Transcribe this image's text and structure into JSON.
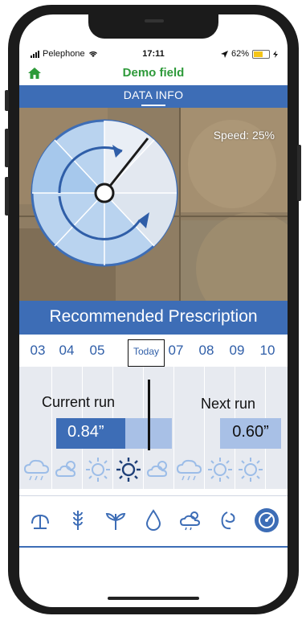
{
  "status": {
    "carrier": "Pelephone",
    "time": "17:11",
    "battery": "62%",
    "battery_level": 0.62
  },
  "header": {
    "title": "Demo field"
  },
  "data_bar": {
    "title": "DATA INFO"
  },
  "map": {
    "speed_text": "Speed: 25%"
  },
  "prescription": {
    "title": "Recommended Prescription",
    "days": [
      "03",
      "04",
      "05",
      "Today",
      "07",
      "08",
      "09",
      "10"
    ],
    "current_label": "Current run",
    "current_value": "0.84”",
    "current_fraction": 0.6,
    "next_label": "Next run",
    "next_value": "0.60”"
  },
  "weather": [
    "rain-cloud-icon",
    "cloudy-sun-icon",
    "sun-icon",
    "sun-icon",
    "cloudy-sun-icon",
    "rain-cloud-icon",
    "sun-icon",
    "sun-icon"
  ],
  "bottom_nav": [
    "pivot-icon",
    "wheat-icon",
    "plant-icon",
    "water-drop-icon",
    "weather-icon",
    "crop-icon",
    "irrigation-target-icon"
  ],
  "colors": {
    "brand_green": "#2e9a3a",
    "accent_blue": "#3d6db6",
    "light_blue": "#a8c0e6"
  }
}
